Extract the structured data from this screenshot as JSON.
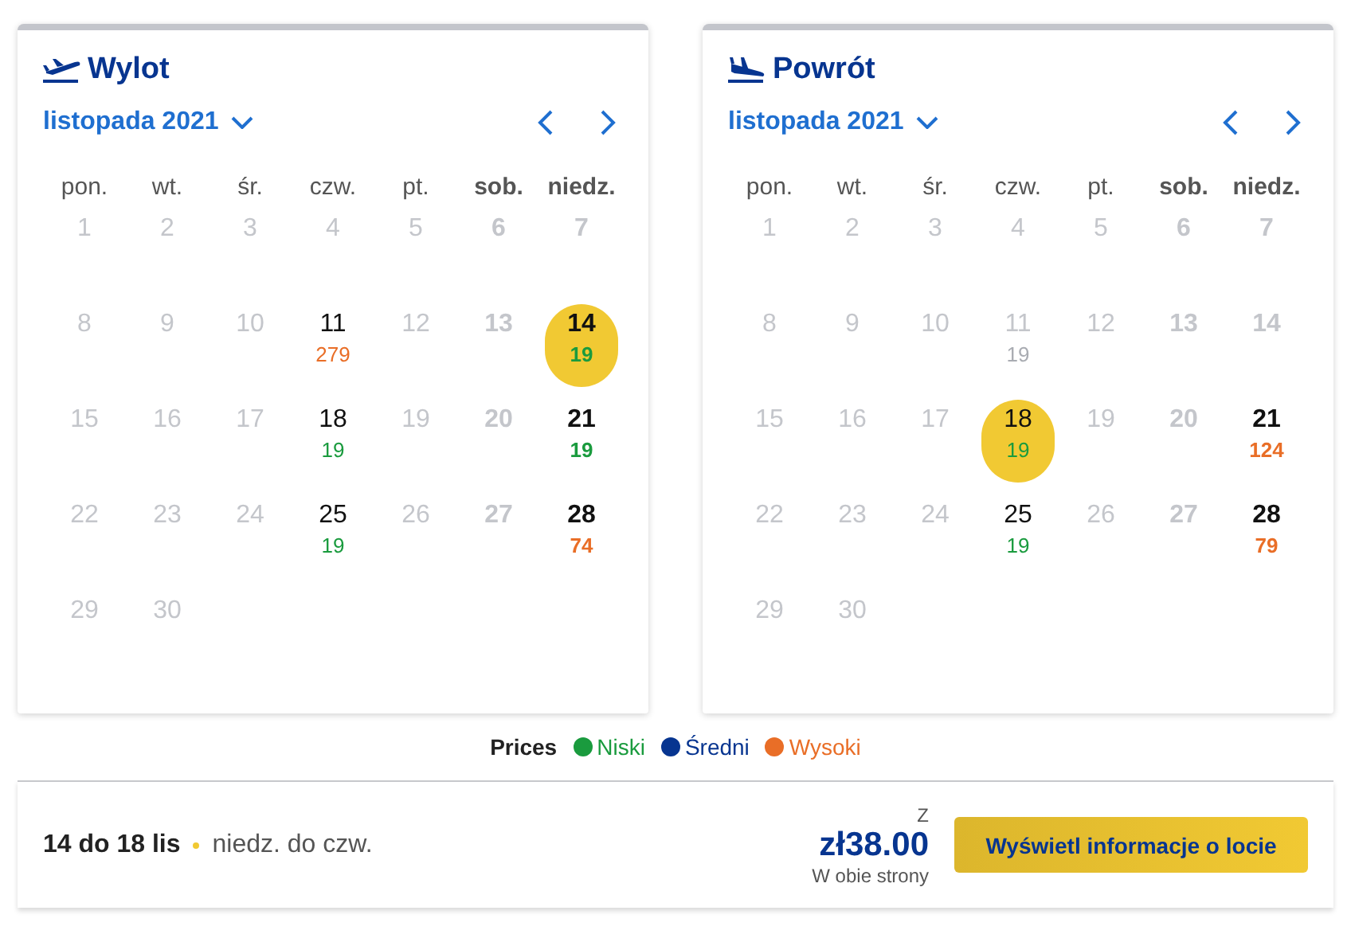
{
  "calendars": [
    {
      "kind": "departure",
      "title": "Wylot",
      "month": "listopada 2021",
      "weekdays": [
        {
          "label": "pon.",
          "weekend": false
        },
        {
          "label": "wt.",
          "weekend": false
        },
        {
          "label": "śr.",
          "weekend": false
        },
        {
          "label": "czw.",
          "weekend": false
        },
        {
          "label": "pt.",
          "weekend": false
        },
        {
          "label": "sob.",
          "weekend": true
        },
        {
          "label": "niedz.",
          "weekend": true
        }
      ],
      "days": [
        {
          "day": "1",
          "available": false,
          "selected": false
        },
        {
          "day": "2",
          "available": false,
          "selected": false
        },
        {
          "day": "3",
          "available": false,
          "selected": false
        },
        {
          "day": "4",
          "available": false,
          "selected": false
        },
        {
          "day": "5",
          "available": false,
          "selected": false
        },
        {
          "day": "6",
          "available": false,
          "selected": false
        },
        {
          "day": "7",
          "available": false,
          "selected": false
        },
        {
          "day": "8",
          "available": false,
          "selected": false
        },
        {
          "day": "9",
          "available": false,
          "selected": false
        },
        {
          "day": "10",
          "available": false,
          "selected": false
        },
        {
          "day": "11",
          "available": true,
          "selected": false,
          "price": "279",
          "color": "#e96e27"
        },
        {
          "day": "12",
          "available": false,
          "selected": false
        },
        {
          "day": "13",
          "available": false,
          "selected": false
        },
        {
          "day": "14",
          "available": true,
          "selected": true,
          "price": "19",
          "color": "#1a9b3e"
        },
        {
          "day": "15",
          "available": false,
          "selected": false
        },
        {
          "day": "16",
          "available": false,
          "selected": false
        },
        {
          "day": "17",
          "available": false,
          "selected": false
        },
        {
          "day": "18",
          "available": true,
          "selected": false,
          "price": "19",
          "color": "#1a9b3e"
        },
        {
          "day": "19",
          "available": false,
          "selected": false
        },
        {
          "day": "20",
          "available": false,
          "selected": false
        },
        {
          "day": "21",
          "available": true,
          "selected": false,
          "price": "19",
          "color": "#1a9b3e"
        },
        {
          "day": "22",
          "available": false,
          "selected": false
        },
        {
          "day": "23",
          "available": false,
          "selected": false
        },
        {
          "day": "24",
          "available": false,
          "selected": false
        },
        {
          "day": "25",
          "available": true,
          "selected": false,
          "price": "19",
          "color": "#1a9b3e"
        },
        {
          "day": "26",
          "available": false,
          "selected": false
        },
        {
          "day": "27",
          "available": false,
          "selected": false
        },
        {
          "day": "28",
          "available": true,
          "selected": false,
          "price": "74",
          "color": "#e96e27"
        },
        {
          "day": "29",
          "available": false,
          "selected": false
        },
        {
          "day": "30",
          "available": false,
          "selected": false
        }
      ]
    },
    {
      "kind": "return",
      "title": "Powrót",
      "month": "listopada 2021",
      "weekdays": [
        {
          "label": "pon.",
          "weekend": false
        },
        {
          "label": "wt.",
          "weekend": false
        },
        {
          "label": "śr.",
          "weekend": false
        },
        {
          "label": "czw.",
          "weekend": false
        },
        {
          "label": "pt.",
          "weekend": false
        },
        {
          "label": "sob.",
          "weekend": true
        },
        {
          "label": "niedz.",
          "weekend": true
        }
      ],
      "days": [
        {
          "day": "1",
          "available": false,
          "selected": false
        },
        {
          "day": "2",
          "available": false,
          "selected": false
        },
        {
          "day": "3",
          "available": false,
          "selected": false
        },
        {
          "day": "4",
          "available": false,
          "selected": false
        },
        {
          "day": "5",
          "available": false,
          "selected": false
        },
        {
          "day": "6",
          "available": false,
          "selected": false
        },
        {
          "day": "7",
          "available": false,
          "selected": false
        },
        {
          "day": "8",
          "available": false,
          "selected": false
        },
        {
          "day": "9",
          "available": false,
          "selected": false
        },
        {
          "day": "10",
          "available": false,
          "selected": false
        },
        {
          "day": "11",
          "available": false,
          "selected": false,
          "price": "19",
          "color": "#a9acb2"
        },
        {
          "day": "12",
          "available": false,
          "selected": false
        },
        {
          "day": "13",
          "available": false,
          "selected": false
        },
        {
          "day": "14",
          "available": false,
          "selected": false
        },
        {
          "day": "15",
          "available": false,
          "selected": false
        },
        {
          "day": "16",
          "available": false,
          "selected": false
        },
        {
          "day": "17",
          "available": false,
          "selected": false
        },
        {
          "day": "18",
          "available": true,
          "selected": true,
          "price": "19",
          "color": "#1a9b3e"
        },
        {
          "day": "19",
          "available": false,
          "selected": false
        },
        {
          "day": "20",
          "available": false,
          "selected": false
        },
        {
          "day": "21",
          "available": true,
          "selected": false,
          "price": "124",
          "color": "#e96e27"
        },
        {
          "day": "22",
          "available": false,
          "selected": false
        },
        {
          "day": "23",
          "available": false,
          "selected": false
        },
        {
          "day": "24",
          "available": false,
          "selected": false
        },
        {
          "day": "25",
          "available": true,
          "selected": false,
          "price": "19",
          "color": "#1a9b3e"
        },
        {
          "day": "26",
          "available": false,
          "selected": false
        },
        {
          "day": "27",
          "available": false,
          "selected": false
        },
        {
          "day": "28",
          "available": true,
          "selected": false,
          "price": "79",
          "color": "#e96e27"
        },
        {
          "day": "29",
          "available": false,
          "selected": false
        },
        {
          "day": "30",
          "available": false,
          "selected": false
        }
      ]
    }
  ],
  "legend": {
    "title": "Prices",
    "items": [
      {
        "label": "Niski",
        "color": "#1a9b3e"
      },
      {
        "label": "Średni",
        "color": "#073590"
      },
      {
        "label": "Wysoki",
        "color": "#e96e27"
      }
    ]
  },
  "summary": {
    "dates": "14 do 18 lis",
    "days": "niedz. do czw.",
    "price_prefix": "Z",
    "price": "zł38.00",
    "price_note": "W obie strony",
    "button": "Wyświetl informacje o locie"
  }
}
